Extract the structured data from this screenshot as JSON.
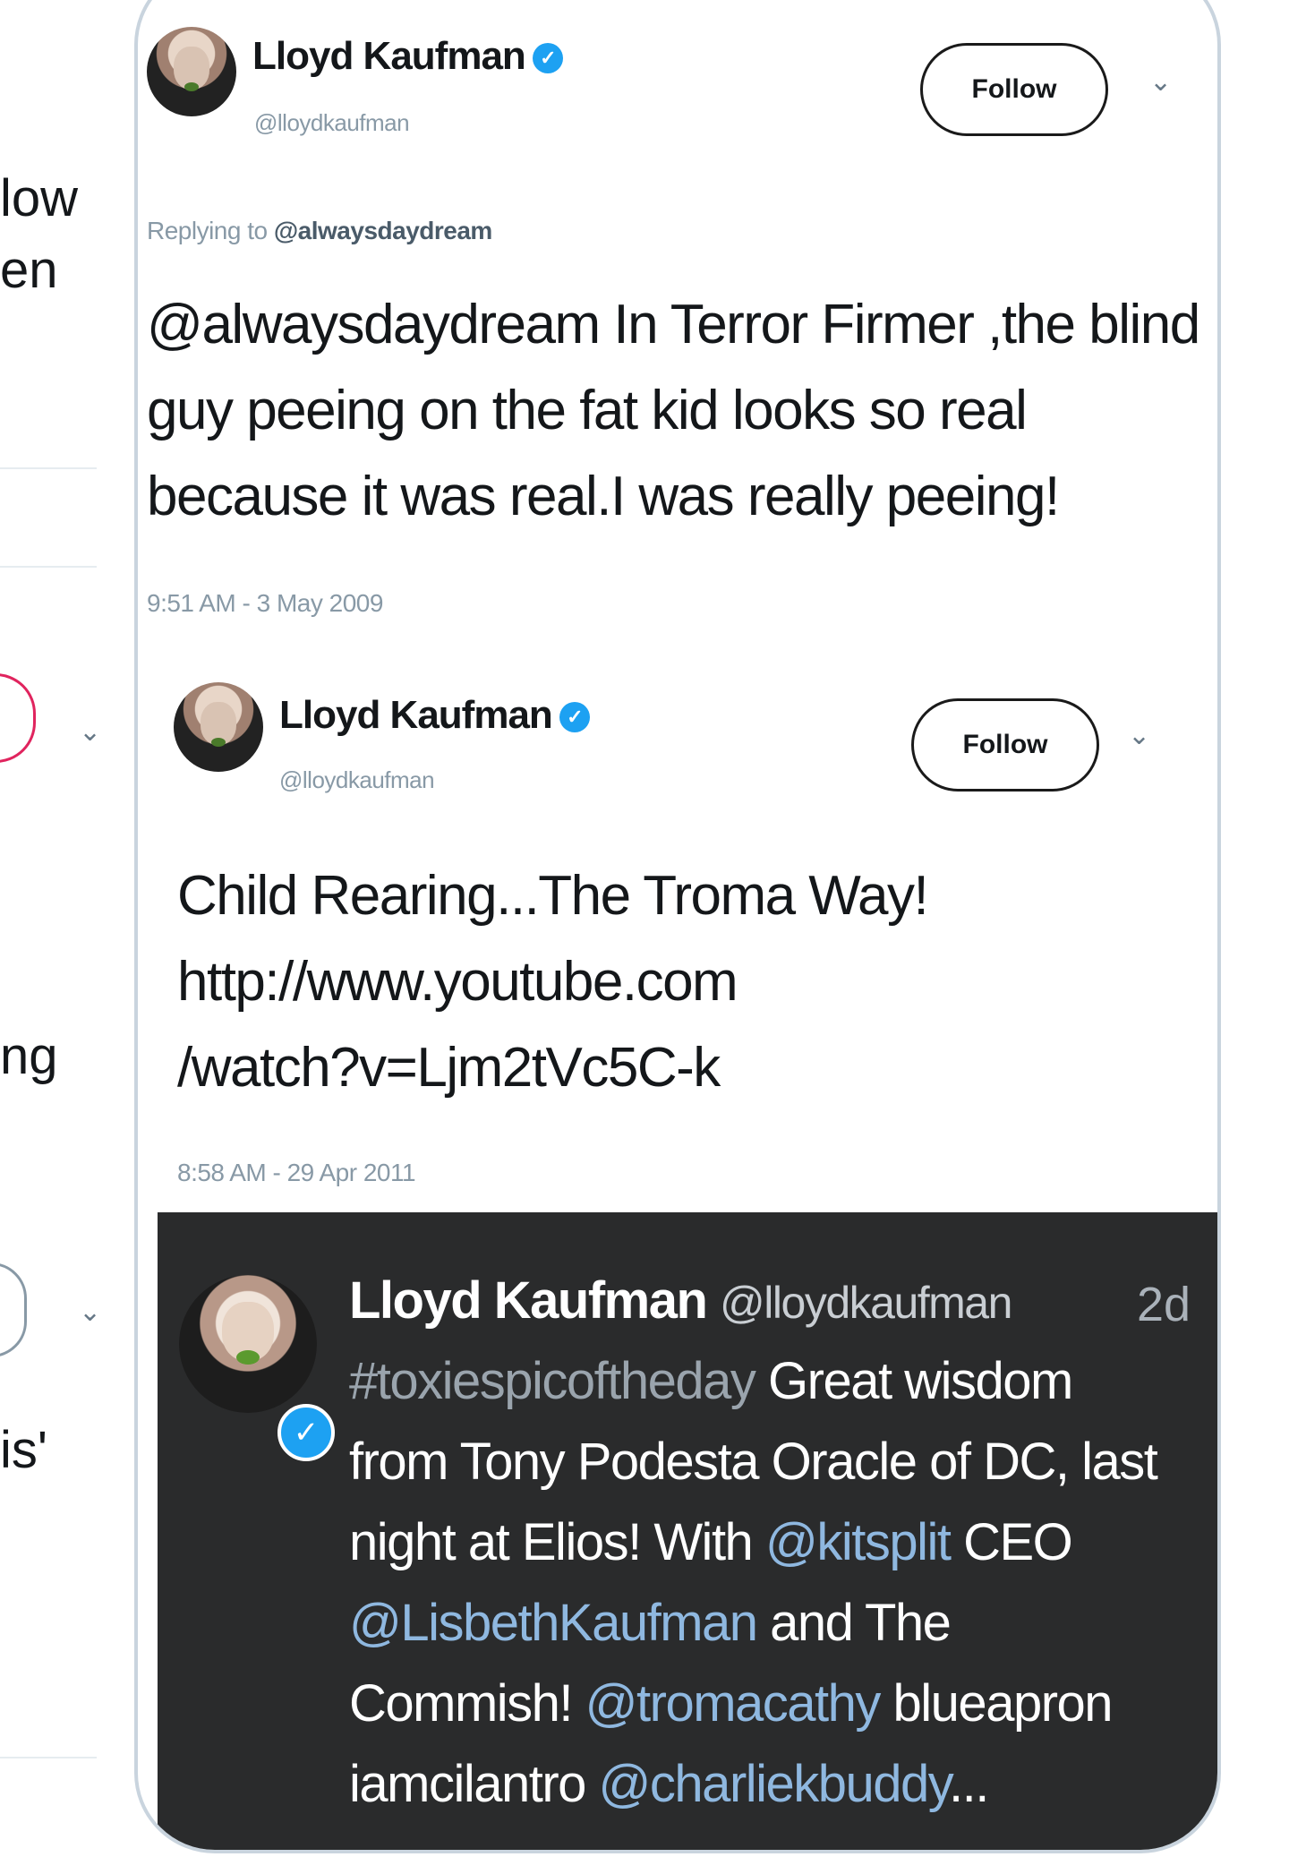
{
  "background_tweet": {
    "fragments": [
      "low",
      "en",
      "ng",
      "is'"
    ]
  },
  "tweet1": {
    "name": "Lloyd Kaufman",
    "handle": "@lloydkaufman",
    "follow_label": "Follow",
    "replying_prefix": "Replying to",
    "replying_handle": "@alwaysdaydream",
    "text_lines": [
      "@alwaysdaydream In Terror Firmer ,the blind",
      "guy peeing on the fat kid looks so real",
      "because it was real.I was really peeing!"
    ],
    "time": "9:51 AM - 3 May 2009"
  },
  "tweet2": {
    "name": "Lloyd Kaufman",
    "handle": "@lloydkaufman",
    "follow_label": "Follow",
    "text_lines": [
      "Child Rearing...The Troma Way!",
      "http://www.youtube.com",
      "/watch?v=Ljm2tVc5C-k"
    ],
    "time": "8:58 AM - 29 Apr 2011"
  },
  "tweet3": {
    "name": "Lloyd Kaufman",
    "handle": "@lloydkaufman",
    "time": "2d",
    "hashtag": "#toxiespicoftheday",
    "line1_rest": " Great wisdom",
    "line2": "from Tony Podesta Oracle of DC, last",
    "line3_a": "night at Elios! With ",
    "line3_mention": "@kitsplit",
    "line3_b": " CEO",
    "line4_mention": "@LisbethKaufman",
    "line4_b": " and The",
    "line5_a": "Commish! ",
    "line5_mention": "@tromacathy",
    "line5_b": " blueapron",
    "line6_a": "iamcilantro ",
    "line6_mention": "@charliekbuddy",
    "line6_b": "..."
  },
  "icons": {
    "verified": "verified-badge-icon",
    "chevron": "chevron-down-icon",
    "check": "✓",
    "chevron_glyph": "⌄"
  },
  "colors": {
    "verified": "#1da1f2",
    "mention": "#8fb8e0",
    "dark_bg": "#2a2b2c",
    "muted": "#8899a6"
  }
}
